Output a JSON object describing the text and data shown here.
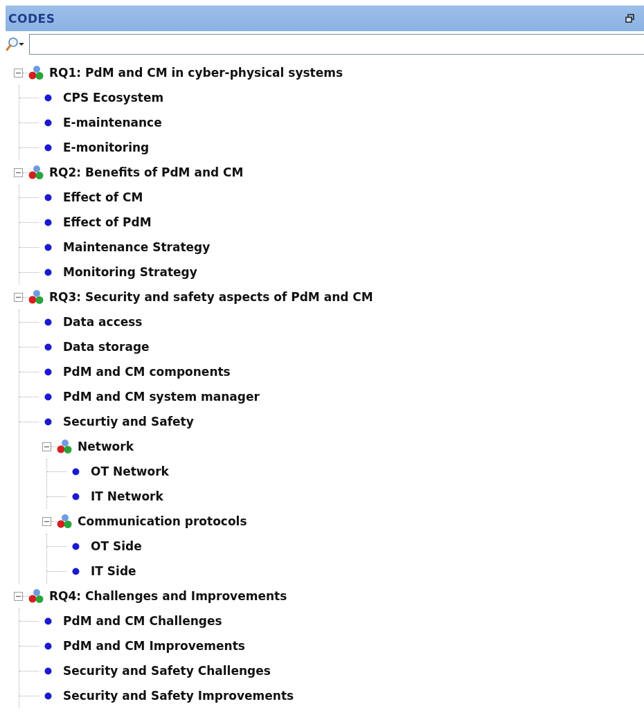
{
  "panel": {
    "title": "CODES"
  },
  "tree": [
    {
      "kind": "group",
      "label": "RQ1: PdM and CM in cyber-physical systems",
      "expanded": true,
      "children": [
        {
          "kind": "code",
          "label": "CPS Ecosystem"
        },
        {
          "kind": "code",
          "label": "E-maintenance"
        },
        {
          "kind": "code",
          "label": "E-monitoring"
        }
      ]
    },
    {
      "kind": "group",
      "label": "RQ2: Benefits of PdM and CM",
      "expanded": true,
      "children": [
        {
          "kind": "code",
          "label": "Effect of CM"
        },
        {
          "kind": "code",
          "label": "Effect of PdM"
        },
        {
          "kind": "code",
          "label": "Maintenance Strategy"
        },
        {
          "kind": "code",
          "label": "Monitoring Strategy"
        }
      ]
    },
    {
      "kind": "group",
      "label": "RQ3: Security and safety aspects of PdM and CM",
      "expanded": true,
      "children": [
        {
          "kind": "code",
          "label": "Data access"
        },
        {
          "kind": "code",
          "label": "Data storage"
        },
        {
          "kind": "code",
          "label": "PdM and CM components"
        },
        {
          "kind": "code",
          "label": "PdM and CM system manager"
        },
        {
          "kind": "code",
          "label": "Securtiy and Safety"
        },
        {
          "kind": "group",
          "label": "Network",
          "expanded": true,
          "children": [
            {
              "kind": "code",
              "label": "OT Network"
            },
            {
              "kind": "code",
              "label": "IT Network"
            }
          ]
        },
        {
          "kind": "group",
          "label": "Communication protocols",
          "expanded": true,
          "children": [
            {
              "kind": "code",
              "label": "OT Side"
            },
            {
              "kind": "code",
              "label": "IT Side"
            }
          ]
        }
      ]
    },
    {
      "kind": "group",
      "label": "RQ4: Challenges and Improvements",
      "expanded": true,
      "children": [
        {
          "kind": "code",
          "label": "PdM and CM Challenges"
        },
        {
          "kind": "code",
          "label": "PdM and CM Improvements"
        },
        {
          "kind": "code",
          "label": "Security and Safety Challenges"
        },
        {
          "kind": "code",
          "label": "Security and Safety Improvements"
        }
      ]
    }
  ]
}
